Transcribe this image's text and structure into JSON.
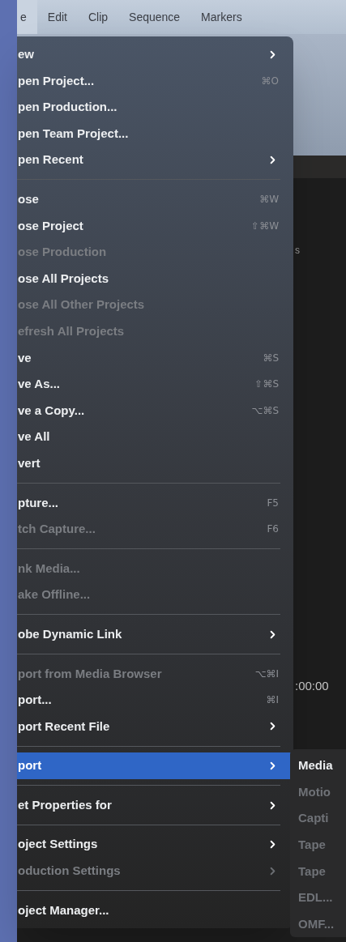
{
  "menu_bar": [
    {
      "label": "e",
      "selected": true
    },
    {
      "label": "Edit",
      "selected": false
    },
    {
      "label": "Clip",
      "selected": false
    },
    {
      "label": "Sequence",
      "selected": false
    },
    {
      "label": "Markers",
      "selected": false
    }
  ],
  "background": {
    "label_1": "s",
    "timecode": ":00:00"
  },
  "menu": {
    "items": [
      {
        "kind": "item",
        "label": "ew",
        "has_submenu": true,
        "disabled": false,
        "selected": false
      },
      {
        "kind": "item",
        "label": "pen Project...",
        "shortcut": "⌘O",
        "has_submenu": false,
        "disabled": false,
        "selected": false
      },
      {
        "kind": "item",
        "label": "pen Production...",
        "has_submenu": false,
        "disabled": false,
        "selected": false
      },
      {
        "kind": "item",
        "label": "pen Team Project...",
        "has_submenu": false,
        "disabled": false,
        "selected": false
      },
      {
        "kind": "item",
        "label": "pen Recent",
        "has_submenu": true,
        "disabled": false,
        "selected": false
      },
      {
        "kind": "separator"
      },
      {
        "kind": "item",
        "label": "ose",
        "shortcut": "⌘W",
        "has_submenu": false,
        "disabled": false,
        "selected": false
      },
      {
        "kind": "item",
        "label": "ose Project",
        "shortcut": "⇧⌘W",
        "has_submenu": false,
        "disabled": false,
        "selected": false
      },
      {
        "kind": "item",
        "label": "ose Production",
        "has_submenu": false,
        "disabled": true,
        "selected": false
      },
      {
        "kind": "item",
        "label": "ose All Projects",
        "has_submenu": false,
        "disabled": false,
        "selected": false
      },
      {
        "kind": "item",
        "label": "ose All Other Projects",
        "has_submenu": false,
        "disabled": true,
        "selected": false
      },
      {
        "kind": "item",
        "label": "efresh All Projects",
        "has_submenu": false,
        "disabled": true,
        "selected": false
      },
      {
        "kind": "item",
        "label": "ve",
        "shortcut": "⌘S",
        "has_submenu": false,
        "disabled": false,
        "selected": false
      },
      {
        "kind": "item",
        "label": "ve As...",
        "shortcut": "⇧⌘S",
        "has_submenu": false,
        "disabled": false,
        "selected": false
      },
      {
        "kind": "item",
        "label": "ve a Copy...",
        "shortcut": "⌥⌘S",
        "has_submenu": false,
        "disabled": false,
        "selected": false
      },
      {
        "kind": "item",
        "label": "ve All",
        "has_submenu": false,
        "disabled": false,
        "selected": false
      },
      {
        "kind": "item",
        "label": "vert",
        "has_submenu": false,
        "disabled": false,
        "selected": false
      },
      {
        "kind": "separator"
      },
      {
        "kind": "item",
        "label": "pture...",
        "shortcut": "F5",
        "has_submenu": false,
        "disabled": false,
        "selected": false
      },
      {
        "kind": "item",
        "label": "tch Capture...",
        "shortcut": "F6",
        "has_submenu": false,
        "disabled": true,
        "selected": false
      },
      {
        "kind": "separator"
      },
      {
        "kind": "item",
        "label": "nk Media...",
        "has_submenu": false,
        "disabled": true,
        "selected": false
      },
      {
        "kind": "item",
        "label": "ake Offline...",
        "has_submenu": false,
        "disabled": true,
        "selected": false
      },
      {
        "kind": "separator"
      },
      {
        "kind": "item",
        "label": "obe Dynamic Link",
        "has_submenu": true,
        "disabled": false,
        "selected": false
      },
      {
        "kind": "separator"
      },
      {
        "kind": "item",
        "label": "port from Media Browser",
        "shortcut": "⌥⌘I",
        "has_submenu": false,
        "disabled": true,
        "selected": false
      },
      {
        "kind": "item",
        "label": "port...",
        "shortcut": "⌘I",
        "has_submenu": false,
        "disabled": false,
        "selected": false
      },
      {
        "kind": "item",
        "label": "port Recent File",
        "has_submenu": true,
        "disabled": false,
        "selected": false
      },
      {
        "kind": "separator"
      },
      {
        "kind": "item",
        "label": "port",
        "has_submenu": true,
        "disabled": false,
        "selected": true,
        "submenu_items": [
          {
            "label": "Media",
            "disabled": false
          },
          {
            "label": "Motio",
            "disabled": true
          },
          {
            "label": "Capti",
            "disabled": true
          },
          {
            "label": "Tape",
            "disabled": true
          },
          {
            "label": "Tape",
            "disabled": true
          },
          {
            "label": "EDL...",
            "disabled": true
          },
          {
            "label": "OMF...",
            "disabled": true
          }
        ]
      },
      {
        "kind": "separator"
      },
      {
        "kind": "item",
        "label": "et Properties for",
        "has_submenu": true,
        "disabled": false,
        "selected": false
      },
      {
        "kind": "separator"
      },
      {
        "kind": "item",
        "label": "oject Settings",
        "has_submenu": true,
        "disabled": false,
        "selected": false
      },
      {
        "kind": "item",
        "label": "oduction Settings",
        "has_submenu": true,
        "disabled": true,
        "selected": false
      },
      {
        "kind": "separator"
      },
      {
        "kind": "item",
        "label": "oject Manager...",
        "has_submenu": false,
        "disabled": false,
        "selected": false
      }
    ]
  }
}
